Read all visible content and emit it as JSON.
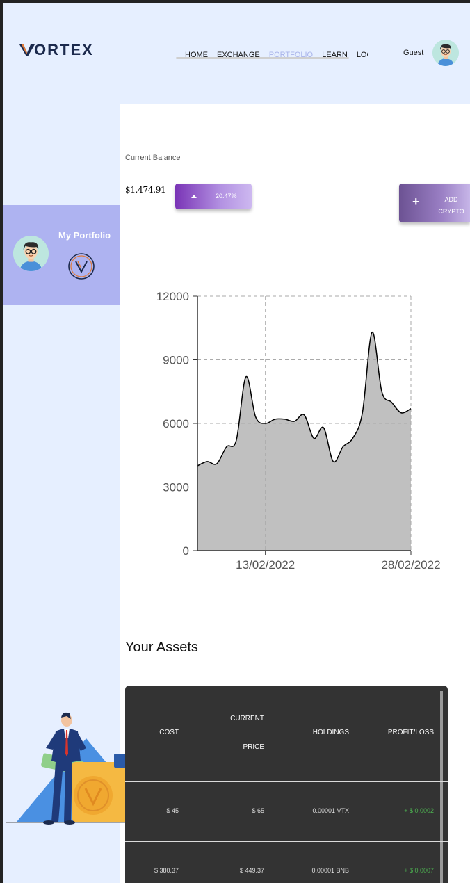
{
  "brand": {
    "name": "ORTEX",
    "accent_color": "#e07b39",
    "text_color": "#1c2a4d"
  },
  "nav": {
    "items": [
      {
        "label": "HOME",
        "active": false
      },
      {
        "label": "EXCHANGE",
        "active": false
      },
      {
        "label": "PORTFOLIO",
        "active": true
      },
      {
        "label": "LEARN",
        "active": false
      },
      {
        "label": "LOGIN",
        "active": false
      }
    ],
    "active_color": "#a9b4ea"
  },
  "user": {
    "name": "Guest",
    "avatar_icon": "user-avatar-icon"
  },
  "sidebar": {
    "card_title": "My Portfolio",
    "card_color": "#aeb3f1",
    "coin_icon": "vortex-coin-icon"
  },
  "balance": {
    "label": "Current Balance",
    "value": "$1,474.91",
    "change": "20.47%",
    "change_direction": "up"
  },
  "add_crypto": {
    "label": "ADD CRYPTO",
    "icon": "plus-icon"
  },
  "chart_data": {
    "type": "area",
    "x": [
      "06/02/2022",
      "07/02/2022",
      "08/02/2022",
      "09/02/2022",
      "10/02/2022",
      "11/02/2022",
      "12/02/2022",
      "13/02/2022",
      "14/02/2022",
      "15/02/2022",
      "16/02/2022",
      "17/02/2022",
      "18/02/2022",
      "19/02/2022",
      "20/02/2022",
      "21/02/2022",
      "22/02/2022",
      "23/02/2022",
      "24/02/2022",
      "25/02/2022",
      "26/02/2022",
      "27/02/2022",
      "28/02/2022"
    ],
    "values": [
      4000,
      4200,
      4100,
      4900,
      5200,
      8200,
      6300,
      6000,
      6200,
      6200,
      6100,
      6400,
      5300,
      5800,
      4200,
      4900,
      5300,
      6500,
      10300,
      7500,
      7000,
      6500,
      6700
    ],
    "x_ticks": [
      "13/02/2022",
      "28/02/2022"
    ],
    "y_ticks": [
      0,
      3000,
      6000,
      9000,
      12000
    ],
    "ylim": [
      0,
      12000
    ],
    "grid": true,
    "fill_color": "#c0c0c0",
    "line_color": "#000000"
  },
  "assets": {
    "title": "Your Assets",
    "columns": {
      "cost": "COST",
      "current_price_line1": "CURRENT",
      "current_price_line2": "PRICE",
      "holdings": "HOLDINGS",
      "profit_loss": "PROFIT/LOSS"
    },
    "rows": [
      {
        "cost": "$ 45",
        "current_price": "$ 65",
        "holdings": "0.00001 VTX",
        "profit_loss": "+ $ 0.0002"
      },
      {
        "cost": "$ 380.37",
        "current_price": "$ 449.37",
        "holdings": "0.00001 BNB",
        "profit_loss": "+ $ 0.0007"
      }
    ],
    "profit_color": "#4caf50"
  }
}
